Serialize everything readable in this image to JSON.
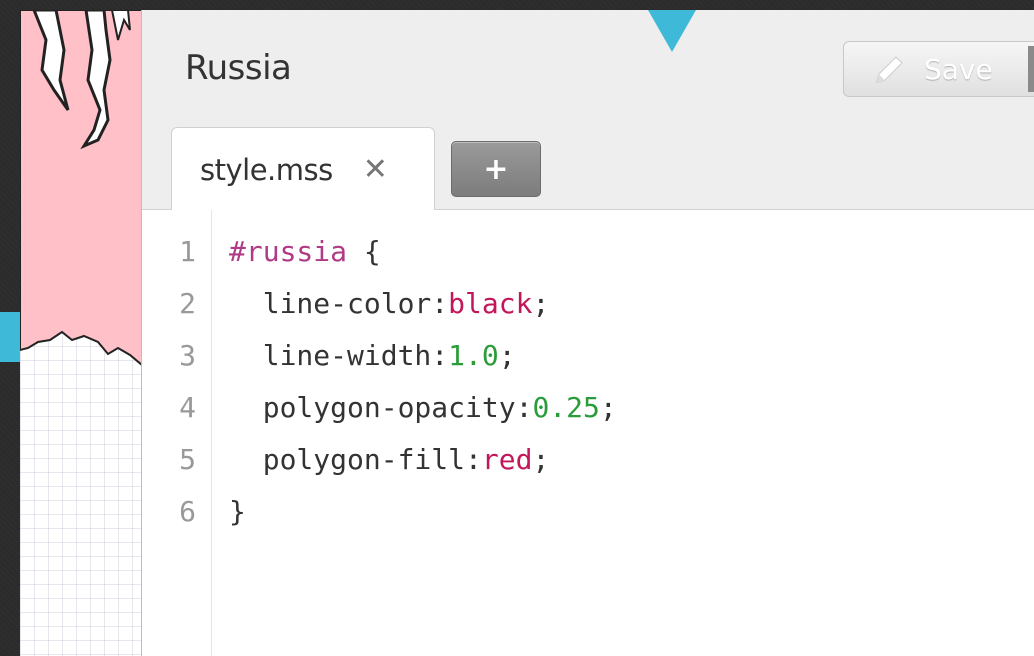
{
  "layer": {
    "title": "Russia",
    "save_label": "Save"
  },
  "tabs": [
    {
      "label": "style.mss",
      "close_glyph": "✕"
    }
  ],
  "add_tab_label": "+",
  "editor": {
    "lines": [
      {
        "number": "1",
        "tokens": [
          {
            "text": "#russia",
            "kind": "selector"
          },
          {
            "text": " {",
            "kind": "punct"
          }
        ]
      },
      {
        "number": "2",
        "tokens": [
          {
            "text": "  line-color:",
            "kind": "prop"
          },
          {
            "text": "black",
            "kind": "keyword"
          },
          {
            "text": ";",
            "kind": "punct"
          }
        ]
      },
      {
        "number": "3",
        "tokens": [
          {
            "text": "  line-width:",
            "kind": "prop"
          },
          {
            "text": "1.0",
            "kind": "number"
          },
          {
            "text": ";",
            "kind": "punct"
          }
        ]
      },
      {
        "number": "4",
        "tokens": [
          {
            "text": "  polygon-opacity:",
            "kind": "prop"
          },
          {
            "text": "0.25",
            "kind": "number"
          },
          {
            "text": ";",
            "kind": "punct"
          }
        ]
      },
      {
        "number": "5",
        "tokens": [
          {
            "text": "  polygon-fill:",
            "kind": "prop"
          },
          {
            "text": "red",
            "kind": "keyword"
          },
          {
            "text": ";",
            "kind": "punct"
          }
        ]
      },
      {
        "number": "6",
        "tokens": [
          {
            "text": "}",
            "kind": "punct"
          }
        ]
      }
    ]
  },
  "icons": {
    "save": "pencil-icon",
    "close": "close-icon",
    "add": "plus-icon"
  },
  "colors": {
    "accent": "#3fb9d8",
    "map_fill": "#ffc0c8",
    "selector": "#b03a86",
    "keyword": "#c2185b",
    "number": "#2a9d3a"
  }
}
